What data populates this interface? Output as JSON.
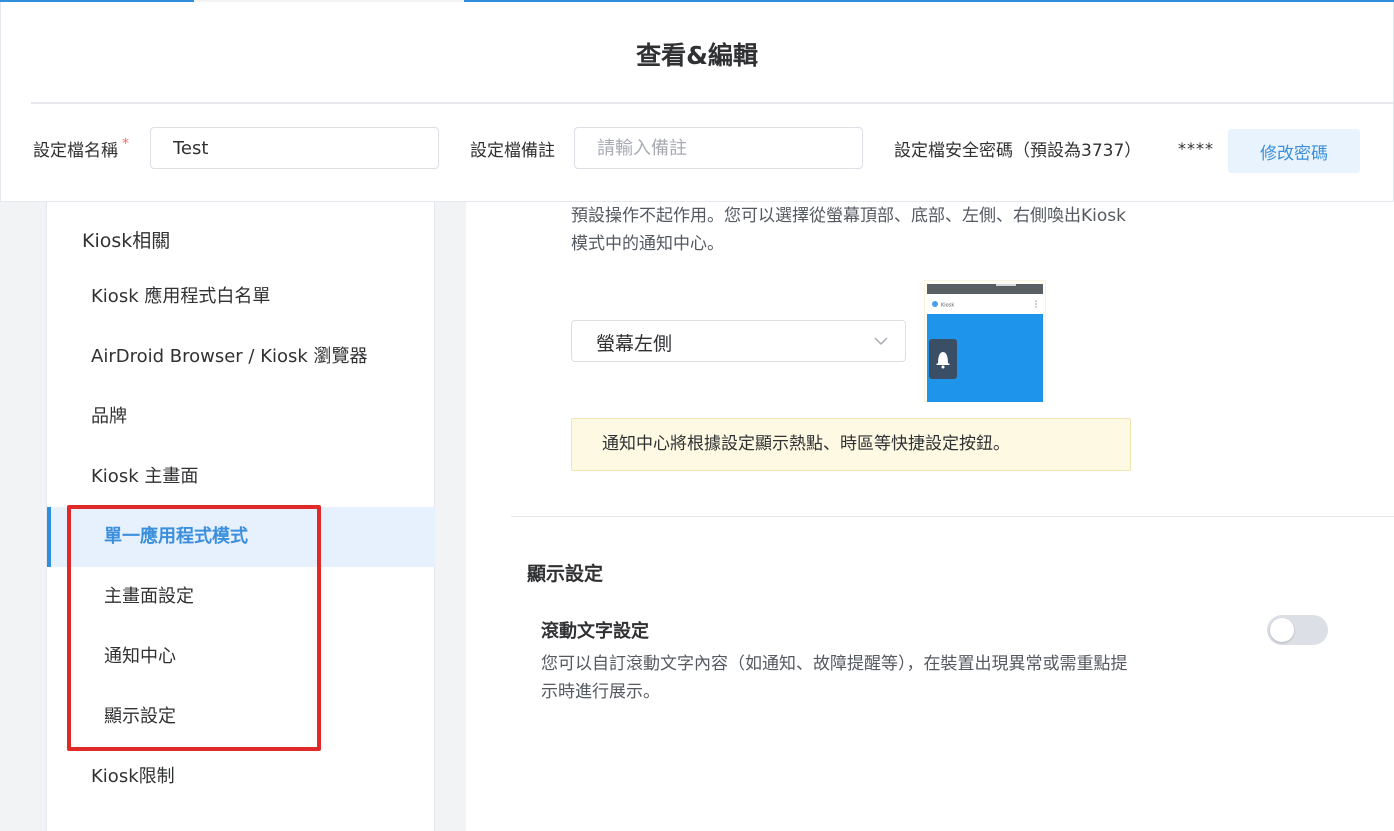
{
  "header": {
    "title": "查看&編輯",
    "profile_name_label": "設定檔名稱",
    "required_mark": "*",
    "profile_name_value": "Test",
    "remark_label": "設定檔備註",
    "remark_placeholder": "請輸入備註",
    "password_label": "設定檔安全密碼（預設為3737）",
    "password_mask": "****",
    "change_password_button": "修改密碼"
  },
  "sidebar": {
    "group_label": "Kiosk相關",
    "items": [
      {
        "label": "Kiosk 應用程式白名單"
      },
      {
        "label": "AirDroid Browser / Kiosk 瀏覽器"
      },
      {
        "label": "品牌"
      },
      {
        "label": "Kiosk 主畫面"
      },
      {
        "label": "單一應用程式模式"
      },
      {
        "label": "主畫面設定"
      },
      {
        "label": "通知中心"
      },
      {
        "label": "顯示設定"
      },
      {
        "label": "Kiosk限制"
      }
    ],
    "active_index": 4
  },
  "main": {
    "notification_desc": "預設操作不起作用。您可以選擇從螢幕頂部、底部、左側、右側喚出Kiosk模式中的通知中心。",
    "position_select_value": "螢幕左側",
    "preview_app_label": "Kiosk",
    "notice_text": "通知中心將根據設定顯示熱點、時區等快捷設定按鈕。",
    "display_section_title": "顯示設定",
    "scroll_text_title": "滾動文字設定",
    "scroll_text_desc": "您可以自訂滾動文字內容（如通知、故障提醒等），在裝置出現異常或需重點提示時進行展示。",
    "scroll_text_enabled": false
  },
  "colors": {
    "accent": "#2f8fdc",
    "highlight_box": "#e02a2a",
    "notice_bg": "#fdf9e3",
    "preview_screen": "#1e95ea"
  }
}
